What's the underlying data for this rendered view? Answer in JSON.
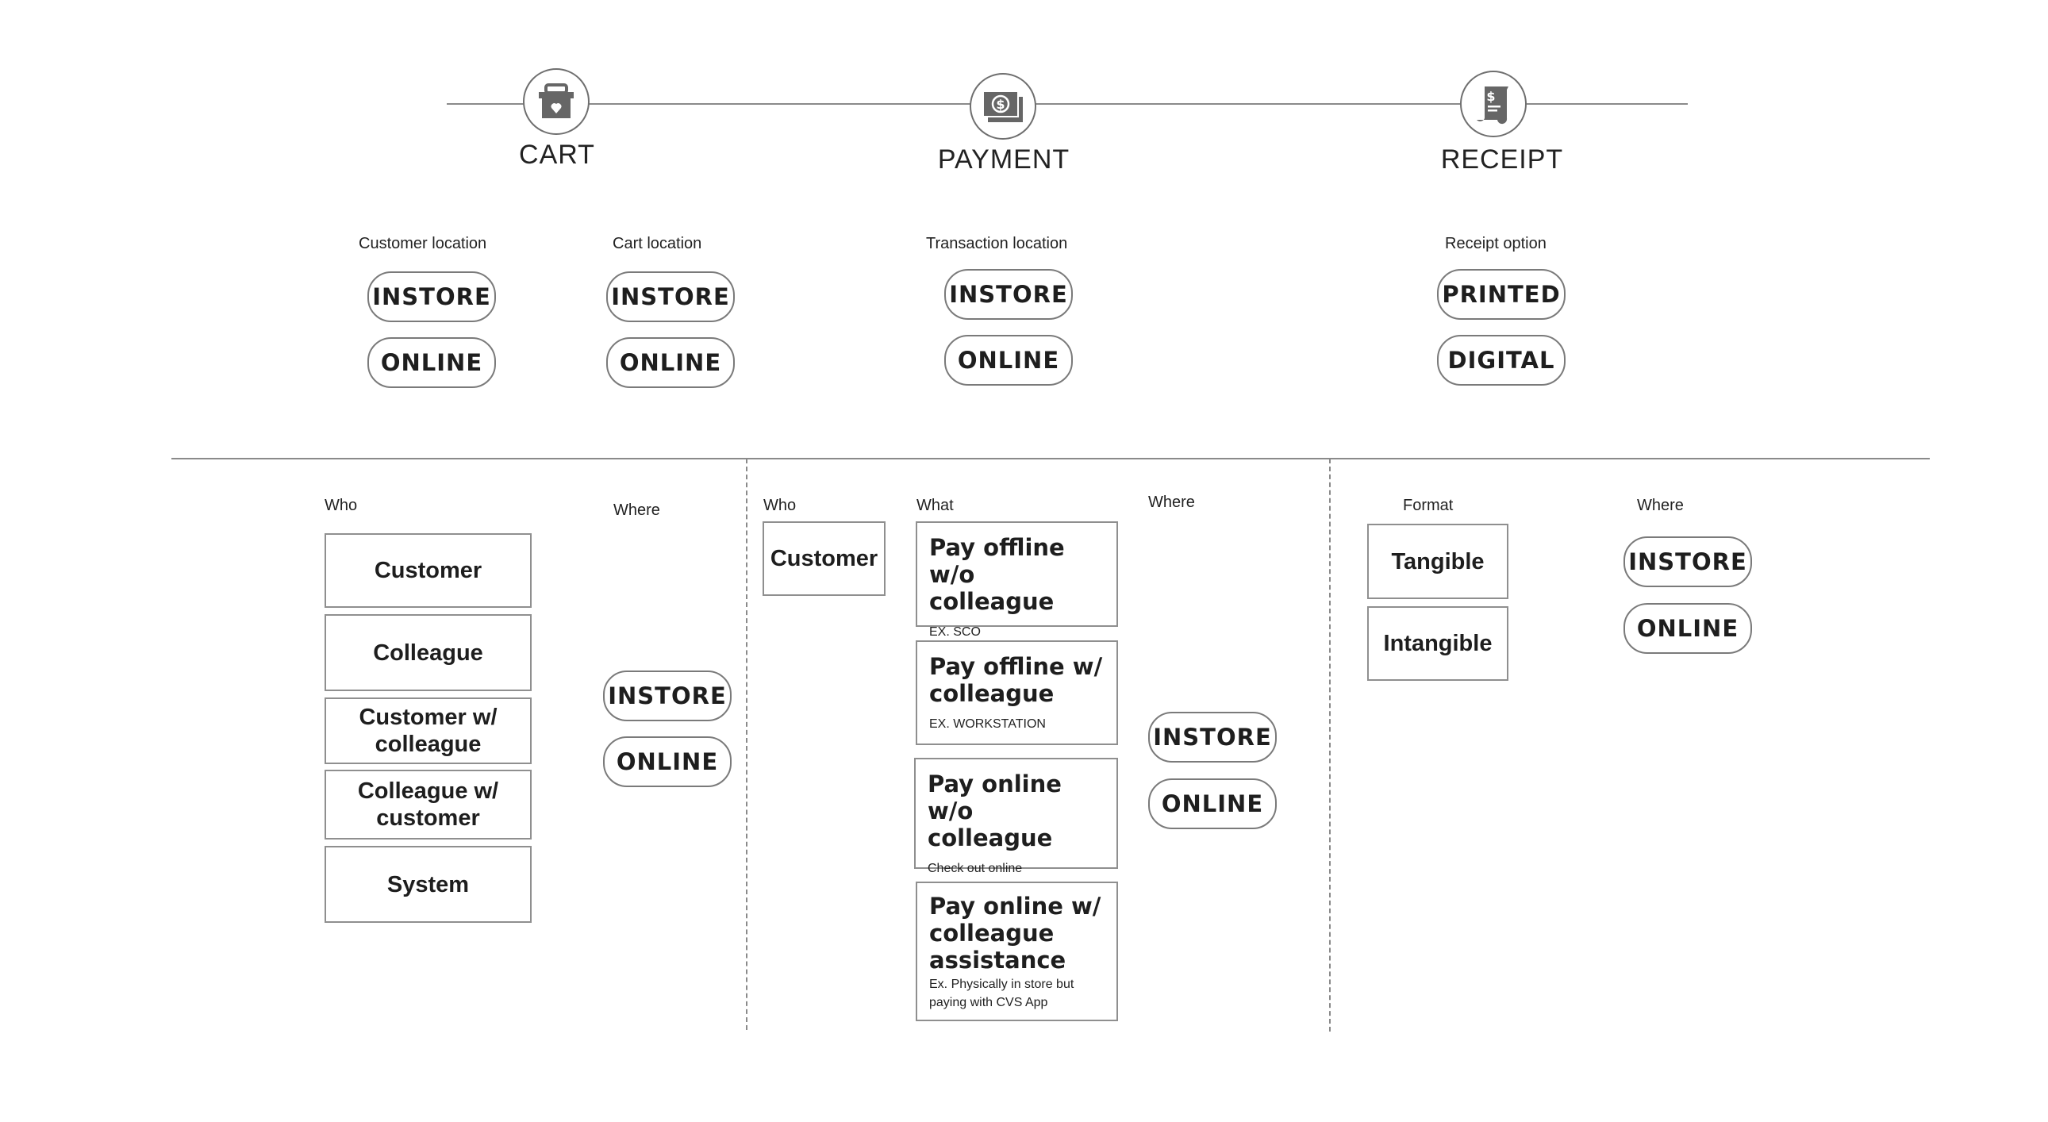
{
  "timeline": {
    "stages": [
      {
        "label": "CART",
        "icon": "basket-heart-icon"
      },
      {
        "label": "PAYMENT",
        "icon": "cash-icon"
      },
      {
        "label": "RECEIPT",
        "icon": "receipt-icon"
      }
    ]
  },
  "top_options": [
    {
      "label": "Customer location",
      "options": [
        "INSTORE",
        "ONLINE"
      ]
    },
    {
      "label": "Cart location",
      "options": [
        "INSTORE",
        "ONLINE"
      ]
    },
    {
      "label": "Transaction location",
      "options": [
        "INSTORE",
        "ONLINE"
      ]
    },
    {
      "label": "Receipt option",
      "options": [
        "PRINTED",
        "DIGITAL"
      ]
    }
  ],
  "cart_section": {
    "who_label": "Who",
    "where_label": "Where",
    "who": [
      "Customer",
      "Colleague",
      "Customer w/ colleague",
      "Colleague w/ customer",
      "System"
    ],
    "where": [
      "INSTORE",
      "ONLINE"
    ]
  },
  "payment_section": {
    "who_label": "Who",
    "what_label": "What",
    "where_label": "Where",
    "who": [
      "Customer"
    ],
    "what": [
      {
        "title": "Pay offline w/o colleague",
        "subtitle": "EX. SCO"
      },
      {
        "title": "Pay offline w/ colleague",
        "subtitle": "EX. WORKSTATION"
      },
      {
        "title": "Pay online w/o colleague",
        "subtitle": "Check out online"
      },
      {
        "title": "Pay online w/ colleague assistance",
        "subtitle": "Ex. Physically in store but paying with CVS App"
      }
    ],
    "where": [
      "INSTORE",
      "ONLINE"
    ]
  },
  "receipt_section": {
    "format_label": "Format",
    "where_label": "Where",
    "format": [
      "Tangible",
      "Intangible"
    ],
    "where": [
      "INSTORE",
      "ONLINE"
    ]
  }
}
